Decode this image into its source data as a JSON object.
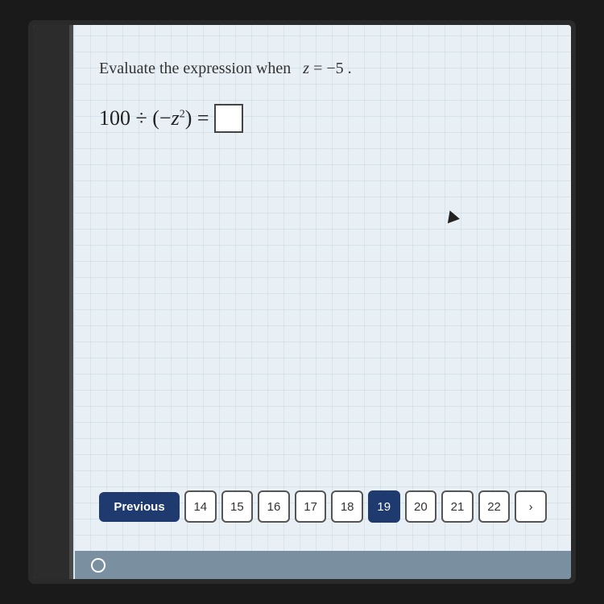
{
  "screen": {
    "problem_intro": "Evaluate the expression when",
    "variable_label": "z = −5 .",
    "expression_prefix": "100 ÷ (−z",
    "expression_suffix": ") =",
    "exponent": "2",
    "answer_placeholder": ""
  },
  "pagination": {
    "previous_label": "Previous",
    "pages": [
      {
        "number": "14",
        "active": false
      },
      {
        "number": "15",
        "active": false
      },
      {
        "number": "16",
        "active": false
      },
      {
        "number": "17",
        "active": false
      },
      {
        "number": "18",
        "active": false
      },
      {
        "number": "19",
        "active": true
      },
      {
        "number": "20",
        "active": false
      },
      {
        "number": "21",
        "active": false
      },
      {
        "number": "22",
        "active": false
      }
    ],
    "next_label": "›"
  },
  "colors": {
    "nav_bg": "#1e3a6e",
    "page_border": "#555555",
    "active_page_bg": "#1e3a6e"
  }
}
